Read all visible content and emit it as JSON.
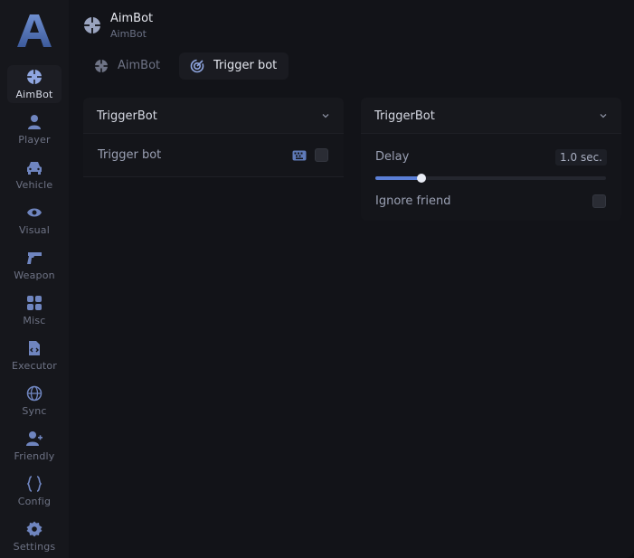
{
  "header": {
    "title": "AimBot",
    "subtitle": "AimBot"
  },
  "sidebar": {
    "items": [
      {
        "label": "AimBot",
        "icon": "crosshair-icon",
        "active": true
      },
      {
        "label": "Player",
        "icon": "user-icon",
        "active": false
      },
      {
        "label": "Vehicle",
        "icon": "car-icon",
        "active": false
      },
      {
        "label": "Visual",
        "icon": "eye-icon",
        "active": false
      },
      {
        "label": "Weapon",
        "icon": "pistol-icon",
        "active": false
      },
      {
        "label": "Misc",
        "icon": "grid-icon",
        "active": false
      },
      {
        "label": "Executor",
        "icon": "script-file-icon",
        "active": false
      },
      {
        "label": "Sync",
        "icon": "globe-icon",
        "active": false
      },
      {
        "label": "Friendly",
        "icon": "user-plus-icon",
        "active": false
      },
      {
        "label": "Config",
        "icon": "braces-icon",
        "active": false
      },
      {
        "label": "Settings",
        "icon": "gear-icon",
        "active": false
      }
    ]
  },
  "tabs": [
    {
      "label": "AimBot",
      "icon": "crosshair-icon",
      "active": false
    },
    {
      "label": "Trigger bot",
      "icon": "target-icon",
      "active": true
    }
  ],
  "panels": {
    "left": {
      "title": "TriggerBot",
      "trigger_bot_label": "Trigger bot",
      "trigger_bot_checked": false
    },
    "right": {
      "title": "TriggerBot",
      "delay_label": "Delay",
      "delay_value": "1.0 sec.",
      "delay_fraction": 0.2,
      "ignore_friend_label": "Ignore friend",
      "ignore_friend_checked": false
    }
  },
  "colors": {
    "accent": "#5b7fd6",
    "background": "#121318",
    "sidebar": "#16171c"
  }
}
